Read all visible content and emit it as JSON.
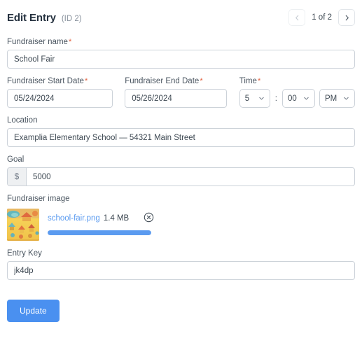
{
  "header": {
    "title": "Edit Entry",
    "entry_id": "(ID 2)",
    "pager": {
      "prev_icon": "chevron-left-icon",
      "next_icon": "chevron-right-icon",
      "label": "1 of 2"
    }
  },
  "form": {
    "required_marker": "*",
    "name": {
      "label": "Fundraiser name",
      "value": "School Fair",
      "placeholder": "Fundraiser name"
    },
    "start_date": {
      "label": "Fundraiser Start Date",
      "value": "05/24/2024",
      "placeholder": "mm/dd/yyyy"
    },
    "end_date": {
      "label": "Fundraiser End Date",
      "value": "05/26/2024",
      "placeholder": "mm/dd/yyyy"
    },
    "time": {
      "label": "Time",
      "hour": "5",
      "minute": "00",
      "meridiem": "PM",
      "separator": ":",
      "chevron_icon": "chevron-down-icon"
    },
    "location": {
      "label": "Location",
      "value": "Examplia Elementary School — 54321 Main Street",
      "placeholder": "Location"
    },
    "goal": {
      "label": "Goal",
      "currency_symbol": "$",
      "value": "5000",
      "placeholder": "0"
    },
    "image": {
      "label": "Fundraiser image",
      "thumbnail_alt": "school-fair-thumbnail",
      "file_name": "school-fair.png",
      "file_size": "1.4 MB",
      "remove_icon": "close-circle-icon",
      "progress_percent": 100
    },
    "entry_key": {
      "label": "Entry Key",
      "value": "jk4dp",
      "placeholder": "Entry Key"
    }
  },
  "actions": {
    "submit_label": "Update"
  },
  "colors": {
    "accent": "#4a90f0",
    "link": "#5b9bf0",
    "required": "#e2603d",
    "border": "#ccd2d9"
  }
}
